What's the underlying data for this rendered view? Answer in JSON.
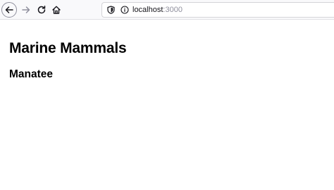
{
  "browser": {
    "icons": {
      "back": "arrow-left-icon",
      "forward": "arrow-right-icon",
      "reload": "reload-icon",
      "home": "home-icon",
      "tracking": "shield-icon",
      "site_info": "info-icon"
    },
    "url": {
      "host": "localhost",
      "port": ":3000"
    }
  },
  "page": {
    "heading": "Marine Mammals",
    "subheading": "Manatee"
  },
  "colors": {
    "toolbar_bg": "#f9f9fb",
    "icon": "#15141a",
    "icon_disabled": "#8f8f9d",
    "text": "#000000"
  }
}
